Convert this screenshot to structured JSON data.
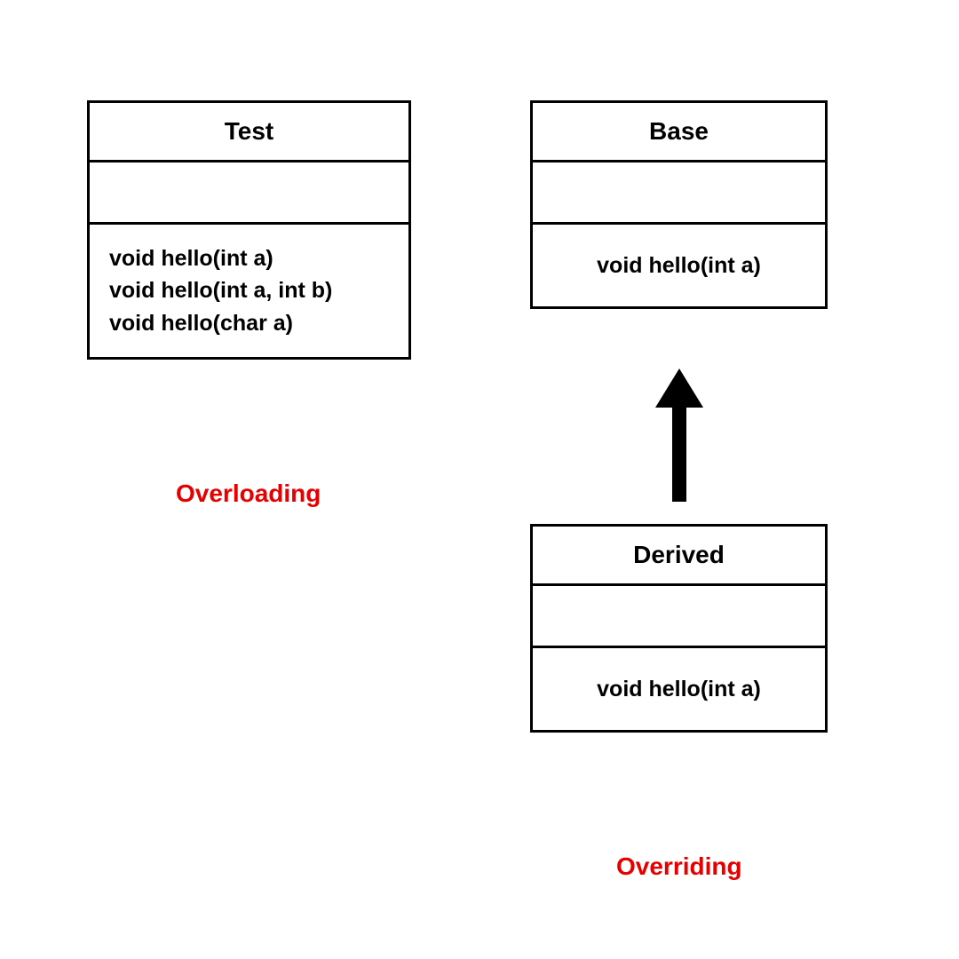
{
  "left": {
    "class_name": "Test",
    "methods": [
      "void hello(int a)",
      "void hello(int a, int b)",
      "void hello(char a)"
    ],
    "caption": "Overloading"
  },
  "right": {
    "base": {
      "class_name": "Base",
      "methods": [
        "void hello(int a)"
      ]
    },
    "derived": {
      "class_name": "Derived",
      "methods": [
        "void hello(int a)"
      ]
    },
    "caption": "Overriding"
  }
}
